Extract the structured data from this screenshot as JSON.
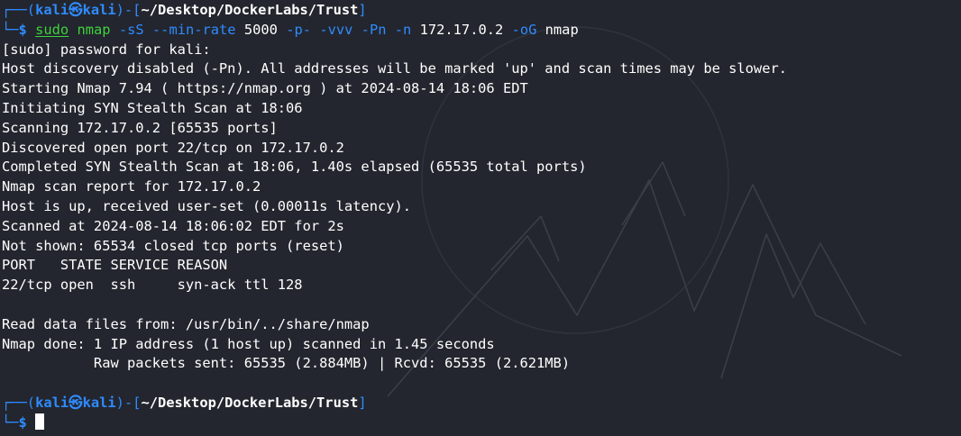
{
  "prompt1": {
    "top_left": "┌──(",
    "user": "kali",
    "at": "㉿",
    "host": "kali",
    "bracket_open": ")-[",
    "path": "~/Desktop/DockerLabs/Trust",
    "bracket_close": "]",
    "bottom_left": "└─",
    "dollar": "$ "
  },
  "command": {
    "sudo": "sudo",
    "nmap": "nmap",
    "args": [
      "-sS",
      "--min-rate",
      "5000",
      "-p-",
      "-vvv",
      "-Pn",
      "-n",
      "172.17.0.2",
      "-oG",
      "nmap"
    ]
  },
  "output_lines": [
    "[sudo] password for kali:",
    "Host discovery disabled (-Pn). All addresses will be marked 'up' and scan times may be slower.",
    "Starting Nmap 7.94 ( https://nmap.org ) at 2024-08-14 18:06 EDT",
    "Initiating SYN Stealth Scan at 18:06",
    "Scanning 172.17.0.2 [65535 ports]",
    "Discovered open port 22/tcp on 172.17.0.2",
    "Completed SYN Stealth Scan at 18:06, 1.40s elapsed (65535 total ports)",
    "Nmap scan report for 172.17.0.2",
    "Host is up, received user-set (0.00011s latency).",
    "Scanned at 2024-08-14 18:06:02 EDT for 2s",
    "Not shown: 65534 closed tcp ports (reset)",
    "PORT   STATE SERVICE REASON",
    "22/tcp open  ssh     syn-ack ttl 128",
    "",
    "Read data files from: /usr/bin/../share/nmap",
    "Nmap done: 1 IP address (1 host up) scanned in 1.45 seconds",
    "           Raw packets sent: 65535 (2.884MB) | Rcvd: 65535 (2.621MB)",
    ""
  ],
  "prompt2": {
    "top_left": "┌──(",
    "user": "kali",
    "at": "㉿",
    "host": "kali",
    "bracket_open": ")-[",
    "path": "~/Desktop/DockerLabs/Trust",
    "bracket_close": "]",
    "bottom_left": "└─",
    "dollar": "$ "
  },
  "colors": {
    "background": "#23262e",
    "prompt_frame": "#2f8bff",
    "command": "#3fd13f",
    "text": "#ffffff"
  },
  "watermark_icon": "kali-dragon-watermark"
}
